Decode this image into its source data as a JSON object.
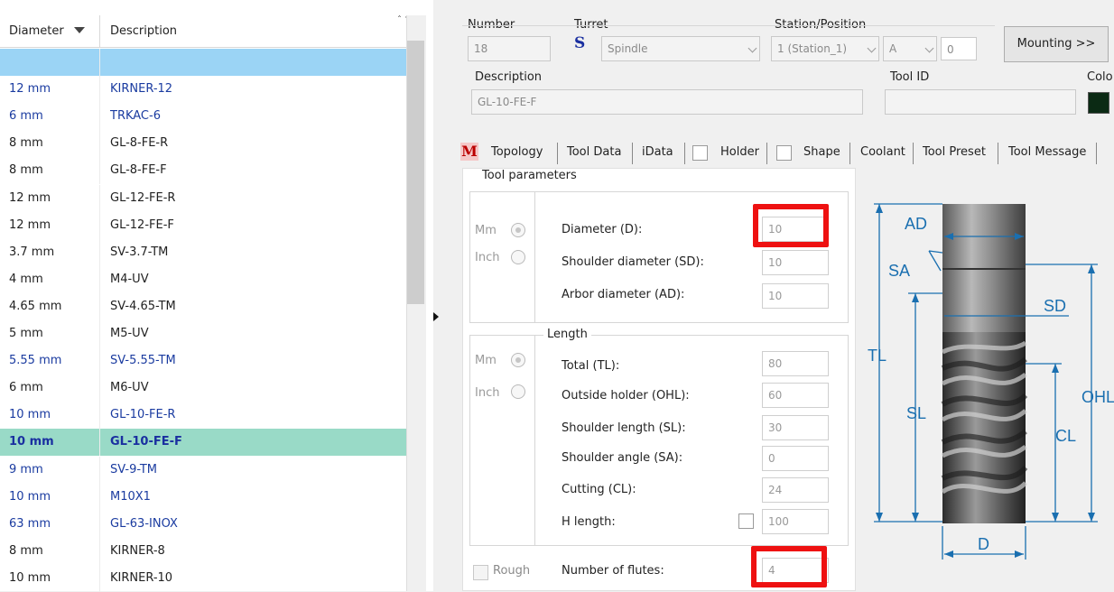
{
  "list": {
    "header": {
      "diameter": "Diameter",
      "description": "Description"
    },
    "rows": [
      {
        "diameter": "",
        "description": "",
        "style": "top"
      },
      {
        "diameter": "12 mm",
        "description": "KIRNER-12",
        "style": "blue"
      },
      {
        "diameter": "6 mm",
        "description": "TRKAC-6",
        "style": "blue"
      },
      {
        "diameter": "8 mm",
        "description": "GL-8-FE-R",
        "style": "black"
      },
      {
        "diameter": "8 mm",
        "description": "GL-8-FE-F",
        "style": "black"
      },
      {
        "diameter": "12 mm",
        "description": "GL-12-FE-R",
        "style": "black"
      },
      {
        "diameter": "12 mm",
        "description": "GL-12-FE-F",
        "style": "black"
      },
      {
        "diameter": "3.7 mm",
        "description": "SV-3.7-TM",
        "style": "black"
      },
      {
        "diameter": "4 mm",
        "description": "M4-UV",
        "style": "black"
      },
      {
        "diameter": "4.65 mm",
        "description": "SV-4.65-TM",
        "style": "black"
      },
      {
        "diameter": "5 mm",
        "description": "M5-UV",
        "style": "black"
      },
      {
        "diameter": "5.55 mm",
        "description": "SV-5.55-TM",
        "style": "blue"
      },
      {
        "diameter": "6 mm",
        "description": "M6-UV",
        "style": "black"
      },
      {
        "diameter": "10 mm",
        "description": "GL-10-FE-R",
        "style": "blue"
      },
      {
        "diameter": "10 mm",
        "description": "GL-10-FE-F",
        "style": "selected"
      },
      {
        "diameter": "9 mm",
        "description": "SV-9-TM",
        "style": "blue"
      },
      {
        "diameter": "10 mm",
        "description": "M10X1",
        "style": "blue"
      },
      {
        "diameter": "63 mm",
        "description": "GL-63-INOX",
        "style": "blue"
      },
      {
        "diameter": "8 mm",
        "description": "KIRNER-8",
        "style": "black"
      },
      {
        "diameter": "10 mm",
        "description": "KIRNER-10",
        "style": "black"
      }
    ]
  },
  "top": {
    "number_label": "Number",
    "number_value": "18",
    "turret_label": "Turret",
    "turret_icon": "S",
    "turret_value": "Spindle",
    "station_label": "Station/Position",
    "station_value": "1 (Station_1)",
    "position_value": "A",
    "offset_value": "0",
    "mounting_button": "Mounting >>",
    "description_label": "Description",
    "description_value": "GL-10-FE-F",
    "toolid_label": "Tool ID",
    "toolid_value": "",
    "color_label": "Colo",
    "color_value": "#0b2a14"
  },
  "tabs": {
    "m_icon": "M",
    "items": [
      "Topology",
      "Tool Data",
      "iData",
      "Holder",
      "Shape",
      "Coolant",
      "Tool Preset",
      "Tool Message"
    ]
  },
  "params": {
    "group_label": "Tool parameters",
    "unit_mm": "Mm",
    "unit_inch": "Inch",
    "diameter_label": "Diameter (D):",
    "diameter_value": "10",
    "shoulder_diameter_label": "Shoulder diameter (SD):",
    "shoulder_diameter_value": "10",
    "arbor_diameter_label": "Arbor diameter (AD):",
    "arbor_diameter_value": "10",
    "length_group_label": "Length",
    "total_label": "Total (TL):",
    "total_value": "80",
    "outside_holder_label": "Outside holder (OHL):",
    "outside_holder_value": "60",
    "shoulder_length_label": "Shoulder length (SL):",
    "shoulder_length_value": "30",
    "shoulder_angle_label": "Shoulder angle (SA):",
    "shoulder_angle_value": "0",
    "cutting_label": "Cutting (CL):",
    "cutting_value": "24",
    "h_length_label": "H length:",
    "h_length_value": "100",
    "rough_label": "Rough",
    "flutes_label": "Number of flutes:",
    "flutes_value": "4"
  },
  "diagram": {
    "labels": {
      "ad": "AD",
      "sa": "SA",
      "sd": "SD",
      "tl": "TL",
      "sl": "SL",
      "ohl": "OHL",
      "cl": "CL",
      "d": "D"
    },
    "accent_color": "#1a6fb0",
    "highlight_color": "#ee1111"
  }
}
